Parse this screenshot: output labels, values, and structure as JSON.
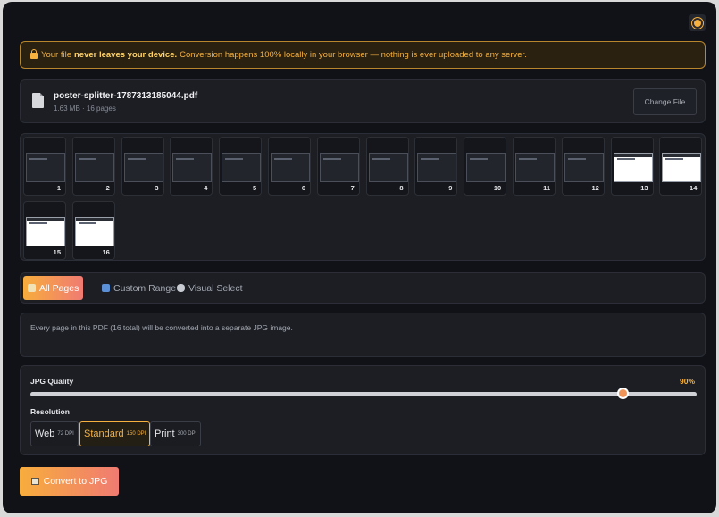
{
  "privacy": {
    "prefix": "Your file",
    "bold": "never leaves your device.",
    "suffix": "Conversion happens 100% locally in your browser — nothing is ever uploaded to any server."
  },
  "file": {
    "name": "poster-splitter-1787313185044.pdf",
    "meta": "1.63 MB · 16 pages",
    "change_label": "Change File"
  },
  "pages": [
    {
      "num": "1"
    },
    {
      "num": "2"
    },
    {
      "num": "3"
    },
    {
      "num": "4"
    },
    {
      "num": "5"
    },
    {
      "num": "6"
    },
    {
      "num": "7"
    },
    {
      "num": "8"
    },
    {
      "num": "9"
    },
    {
      "num": "10"
    },
    {
      "num": "11"
    },
    {
      "num": "12"
    },
    {
      "num": "13"
    },
    {
      "num": "14"
    },
    {
      "num": "15"
    },
    {
      "num": "16"
    }
  ],
  "tabs": {
    "all": "All Pages",
    "custom": "Custom Range",
    "visual": "Visual Select"
  },
  "description": "Every page in this PDF (16 total) will be converted into a separate JPG image.",
  "quality": {
    "label": "JPG Quality",
    "value_text": "90%",
    "value": 90
  },
  "resolution": {
    "label": "Resolution",
    "options": [
      {
        "name": "Web",
        "dpi": "72 DPI"
      },
      {
        "name": "Standard",
        "dpi": "150 DPI"
      },
      {
        "name": "Print",
        "dpi": "300 DPI"
      }
    ],
    "selected": "Standard"
  },
  "convert_label": "Convert to JPG",
  "colors": {
    "accent": "#f6b13e",
    "gradient_end": "#f07b72",
    "background": "#111217"
  }
}
